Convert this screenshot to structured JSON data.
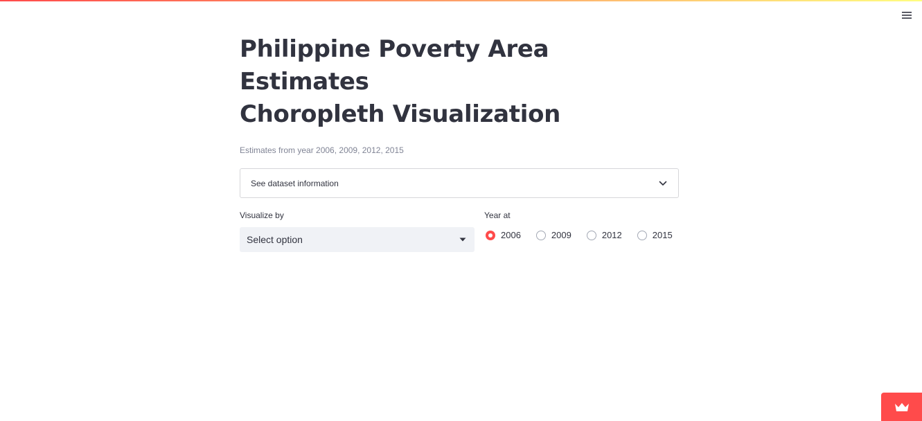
{
  "app": {
    "title_line1": "Philippine Poverty Area Estimates",
    "title_line2": "Choropleth Visualization",
    "subtitle": "Estimates from year 2006, 2009, 2012, 2015"
  },
  "expander": {
    "label": "See dataset information",
    "icon": "chevron-down-icon"
  },
  "visualize": {
    "label": "Visualize by",
    "selected": "Select option",
    "icon": "caret-down-icon"
  },
  "year": {
    "label": "Year at",
    "options": [
      "2006",
      "2009",
      "2012",
      "2015"
    ],
    "selected": "2006"
  },
  "header": {
    "menu_icon": "hamburger-menu-icon"
  },
  "badge": {
    "icon": "crown-icon"
  },
  "colors": {
    "accent": "#ff4b4b",
    "text": "#31333f",
    "muted": "#808495",
    "select_bg": "#f0f2f6"
  }
}
